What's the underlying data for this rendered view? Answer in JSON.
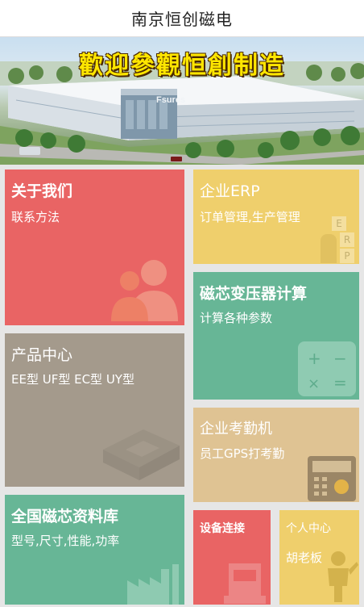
{
  "header": {
    "title": "南京恒创磁电"
  },
  "banner": {
    "caption": "歡迎參觀恒創制造",
    "sign_text": "Fsures"
  },
  "tiles": {
    "about": {
      "title": "关于我们",
      "sub": "联系方法",
      "color": "#e96464"
    },
    "erp": {
      "title": "企业ERP",
      "sub": "订单管理,生产管理",
      "color": "#efcf6c",
      "icon_letters": [
        "E",
        "R",
        "P"
      ]
    },
    "calc": {
      "title": "磁芯变压器计算",
      "sub": "计算各种参数",
      "color": "#67b696",
      "icon": "calculator-icon"
    },
    "products": {
      "title": "产品中心",
      "sub": "EE型 UF型 EC型 UY型",
      "color": "#a49a8c",
      "icon": "core-shape-icon"
    },
    "attendance": {
      "title": "企业考勤机",
      "sub": "员工GPS打考勤",
      "color": "#dfc393",
      "icon": "fingerprint-device-icon"
    },
    "library": {
      "title": "全国磁芯资料库",
      "sub": "型号,尺寸,性能,功率",
      "color": "#67b696",
      "icon": "factory-icon"
    },
    "device": {
      "title": "设备连接",
      "color": "#e96464",
      "icon": "machine-icon"
    },
    "profile": {
      "title": "个人中心",
      "sub": "胡老板",
      "color": "#efcf6c",
      "icon": "person-icon"
    }
  }
}
